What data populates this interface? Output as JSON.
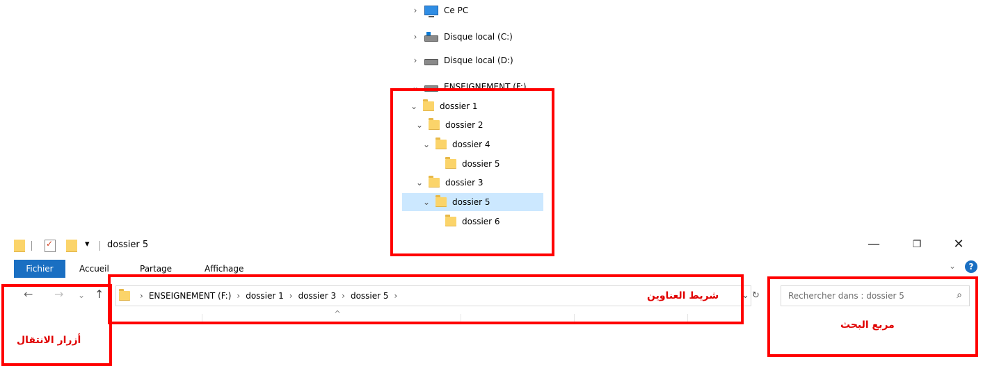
{
  "tree": {
    "items": [
      {
        "label": "Ce PC",
        "icon": "computer-icon",
        "expanded": false
      },
      {
        "label": "Disque local (C:)",
        "icon": "windows-drive-icon",
        "expanded": false
      },
      {
        "label": "Disque local (D:)",
        "icon": "drive-icon",
        "expanded": false
      },
      {
        "label": "ENSEIGNEMENT (F:)",
        "icon": "drive-icon",
        "expanded": true
      },
      {
        "label": "dossier 1",
        "icon": "folder-icon",
        "expanded": true
      },
      {
        "label": "dossier 2",
        "icon": "folder-icon",
        "expanded": true
      },
      {
        "label": "dossier 4",
        "icon": "folder-icon",
        "expanded": true
      },
      {
        "label": "dossier 5",
        "icon": "folder-icon",
        "expanded": false
      },
      {
        "label": "dossier 3",
        "icon": "folder-icon",
        "expanded": true
      },
      {
        "label": "dossier 5",
        "icon": "folder-icon",
        "expanded": true,
        "selected": true
      },
      {
        "label": "dossier 6",
        "icon": "folder-icon",
        "expanded": false
      }
    ]
  },
  "titlebar": {
    "title": "dossier 5",
    "quick_access_arrow": "▾"
  },
  "window_controls": {
    "minimize": "—",
    "restore": "❐",
    "close": "✕"
  },
  "ribbon": {
    "tabs": [
      "Fichier",
      "Accueil",
      "Partage",
      "Affichage"
    ],
    "help": "?"
  },
  "nav": {
    "back": "←",
    "forward": "→",
    "recent": "⌄",
    "up": "↑"
  },
  "address": {
    "crumbs": [
      "ENSEIGNEMENT (F:)",
      "dossier 1",
      "dossier 3",
      "dossier 5"
    ],
    "separator": "›"
  },
  "search": {
    "placeholder": "Rechercher dans : dossier 5"
  },
  "annotations": {
    "address_bar": "شريط العناوين",
    "search_box": "مربع البحث",
    "nav_buttons": "أزرار الانتقال"
  },
  "colors": {
    "annotation": "#ff0000",
    "selection": "#cce8ff",
    "file_tab": "#1a6fc2"
  }
}
